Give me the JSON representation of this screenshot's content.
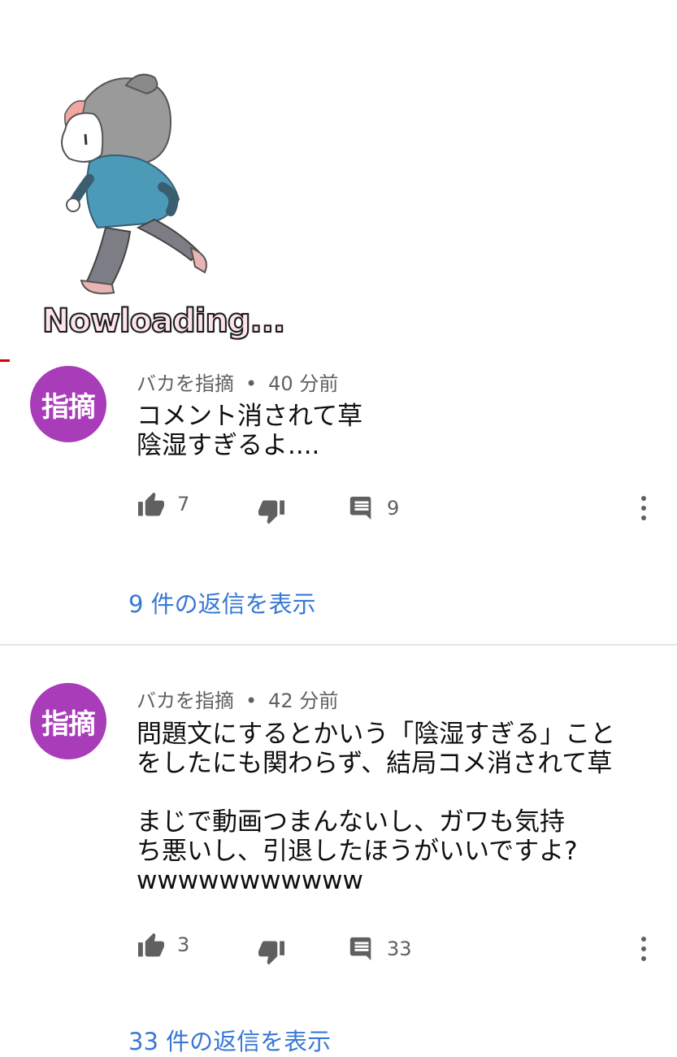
{
  "loading": {
    "text": "Nowloading..."
  },
  "comments": [
    {
      "avatar_text": "指摘",
      "author": "バカを指摘",
      "separator": "•",
      "time": "40 分前",
      "text": "コメント消されて草\n陰湿すぎるよ....",
      "likes": "7",
      "replies_count": "9",
      "replies_link": "9 件の返信を表示"
    },
    {
      "avatar_text": "指摘",
      "author": "バカを指摘",
      "separator": "•",
      "time": "42 分前",
      "text": "問題文にするとかいう「陰湿すぎる」こと\nをしたにも関わらず、結局コメ消されて草\n\nまじで動画つまんないし、ガワも気持\nち悪いし、引退したほうがいいですよ?\nwwwwwwwwwww",
      "likes": "3",
      "replies_count": "33",
      "replies_link": "33 件の返信を表示"
    }
  ],
  "colors": {
    "avatar": "#a83cb9",
    "link": "#3878d4",
    "icon": "#606060"
  }
}
